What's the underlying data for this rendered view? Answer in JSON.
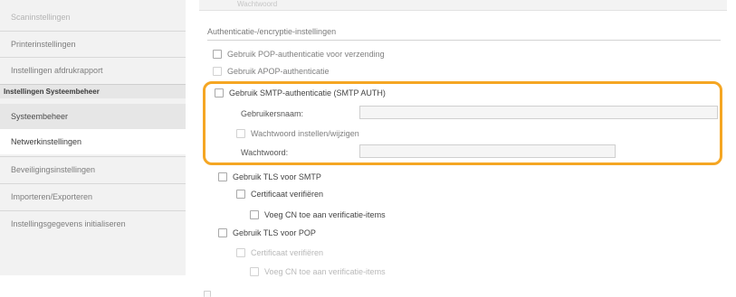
{
  "sidebar": {
    "items": [
      {
        "label": "Scaninstellingen"
      },
      {
        "label": "Printerinstellingen"
      },
      {
        "label": "Instellingen afdrukrapport"
      },
      {
        "label": "Systeembeheer"
      },
      {
        "label": "Netwerkinstellingen"
      },
      {
        "label": "Beveiligingsinstellingen"
      },
      {
        "label": "Importeren/Exporteren"
      },
      {
        "label": "Instellingsgegevens initialiseren"
      }
    ],
    "group_header": "Instellingen Systeembeheer"
  },
  "top_field": {
    "label": "Wachtwoord"
  },
  "section": {
    "title": "Authenticatie-/encryptie-instellingen",
    "pop_auth": "Gebruik POP-authenticatie voor verzending",
    "apop_auth": "Gebruik APOP-authenticatie",
    "smtp_auth": "Gebruik SMTP-authenticatie (SMTP AUTH)",
    "username_label": "Gebruikersnaam:",
    "username_value": "",
    "set_password": "Wachtwoord instellen/wijzigen",
    "password_label": "Wachtwoord:",
    "password_value": "",
    "tls_smtp": "Gebruik TLS voor SMTP",
    "verify_cert_smtp": "Certificaat verifiëren",
    "add_cn_smtp": "Voeg CN toe aan verificatie-items",
    "tls_pop": "Gebruik TLS voor POP",
    "verify_cert_pop": "Certificaat verifiëren",
    "add_cn_pop": "Voeg CN toe aan verificatie-items"
  },
  "highlight_color": "#f5a623"
}
